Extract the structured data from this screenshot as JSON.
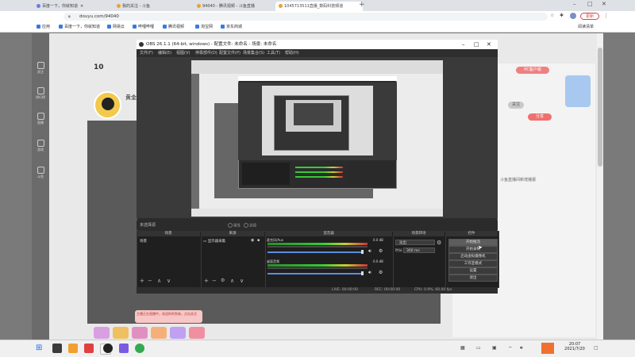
{
  "browser": {
    "tabs": [
      {
        "label": "百度一下，你就知道",
        "active": false
      },
      {
        "label": "我的关注 - 斗鱼",
        "active": false
      },
      {
        "label": "94040 - 腾讯视频 - 斗鱼直播",
        "active": false
      },
      {
        "label": "1045713511直播_数码科技频道",
        "active": true
      }
    ],
    "new_tab": "+",
    "address": "douyu.com/94040",
    "bookmarks": [
      "应用",
      "百度一下，你就知道",
      "网易云",
      "哔哩哔哩",
      "腾讯视频",
      "淘宝网",
      "京东商城"
    ],
    "profile_label": "更新",
    "reading_list": "阅读清单",
    "window_controls": [
      "–",
      "□",
      "✕"
    ],
    "nav": [
      "←",
      "→",
      "⟳"
    ]
  },
  "douyu": {
    "followers": "10",
    "streamer_name": "黄金",
    "left_nav": [
      "关注",
      "排行榜",
      "直播",
      "游戏",
      "斗鱼"
    ],
    "side_note": "斗鱼直播间新增播报",
    "chat_message": "主播正在直播中，欢迎你的到来，点击关注",
    "pills": [
      "PC客户端",
      "关注",
      "分享"
    ]
  },
  "obs": {
    "title": "OBS 26.1.1 (64-bit, windows) - 配置文件: 未命名 - 场景: 未命名",
    "menu": [
      "文件(F)",
      "编辑(E)",
      "视图(V)",
      "停靠部件(D)",
      "配置文件(P)",
      "场景集合(S)",
      "工具(T)",
      "帮助(H)"
    ],
    "scene_bar_label": "未选择源",
    "scene_bar_radios": [
      "属性",
      "滤镜"
    ],
    "docks": {
      "scenes": {
        "title": "场景",
        "items": [
          "场景"
        ]
      },
      "sources": {
        "title": "来源",
        "items": [
          "显示器采集"
        ]
      },
      "mixer": {
        "title": "混音器",
        "channels": [
          {
            "name": "麦克风/Aux",
            "db": "0.0 dB"
          },
          {
            "name": "桌面音频",
            "db": "0.0 dB"
          }
        ]
      },
      "transitions": {
        "title": "场景转场",
        "type": "淡出",
        "duration_label": "时长",
        "duration_value": "300 ms"
      },
      "controls": {
        "title": "控件",
        "buttons": [
          "开始推流",
          "开始录制",
          "启动虚拟摄像机",
          "工作室模式",
          "设置",
          "退出"
        ]
      }
    },
    "dock_buttons": [
      "+",
      "−",
      "∧",
      "∨"
    ],
    "status": {
      "live": "LIVE: 00:00:00",
      "rec": "REC: 00:00:00",
      "cpu": "CPU: 0.9%, 60.00 fps"
    }
  },
  "taskbar": {
    "time": "20:07",
    "date": "2021/7/20"
  },
  "colors": {
    "obs_bg": "#2b2b2b",
    "accent": "#1a73e8"
  }
}
